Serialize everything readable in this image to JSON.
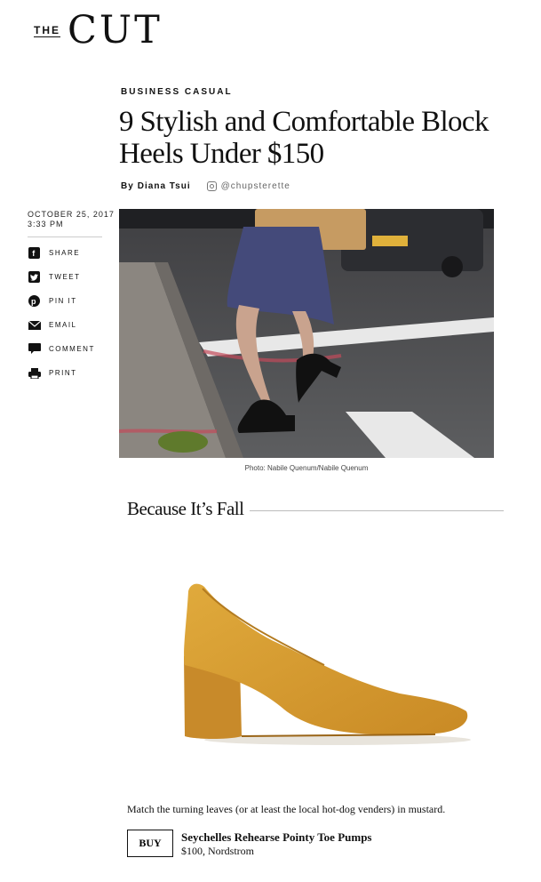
{
  "logo": {
    "the": "THE",
    "cut": "CUT"
  },
  "article": {
    "rubric": "BUSINESS CASUAL",
    "title": "9 Stylish and Comfortable Block Heels Under $150",
    "byline_prefix": "By",
    "author": "Diana Tsui",
    "instagram_handle": "@chupsterette",
    "date": "OCTOBER 25, 2017",
    "time": "3:33 PM",
    "photo_credit": "Photo: Nabile Quenum/Nabile Quenum"
  },
  "share": [
    {
      "label": "SHARE",
      "icon": "facebook-icon"
    },
    {
      "label": "TWEET",
      "icon": "twitter-icon"
    },
    {
      "label": "PIN IT",
      "icon": "pinterest-icon"
    },
    {
      "label": "EMAIL",
      "icon": "email-icon"
    },
    {
      "label": "COMMENT",
      "icon": "comment-icon"
    },
    {
      "label": "PRINT",
      "icon": "print-icon"
    }
  ],
  "section": {
    "heading": "Because It’s Fall"
  },
  "product": {
    "caption": "Match the turning leaves (or at least the local hot-dog venders) in mustard.",
    "buy_label": "BUY",
    "name": "Seychelles Rehearse Pointy Toe Pumps",
    "price": "$100, Nordstrom",
    "color": "#d49a2c"
  }
}
